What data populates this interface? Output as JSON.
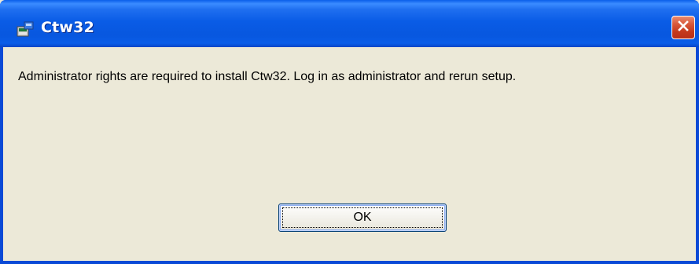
{
  "window": {
    "title": "Ctw32",
    "icon": "installer-icon",
    "close_icon": "close-icon"
  },
  "dialog": {
    "message": "Administrator rights are required to install Ctw32.  Log in as administrator and rerun setup.",
    "ok_label": "OK"
  },
  "colors": {
    "titlebar": "#0a5ce6",
    "close_button": "#c4381c",
    "dialog_background": "#ece9d8"
  }
}
